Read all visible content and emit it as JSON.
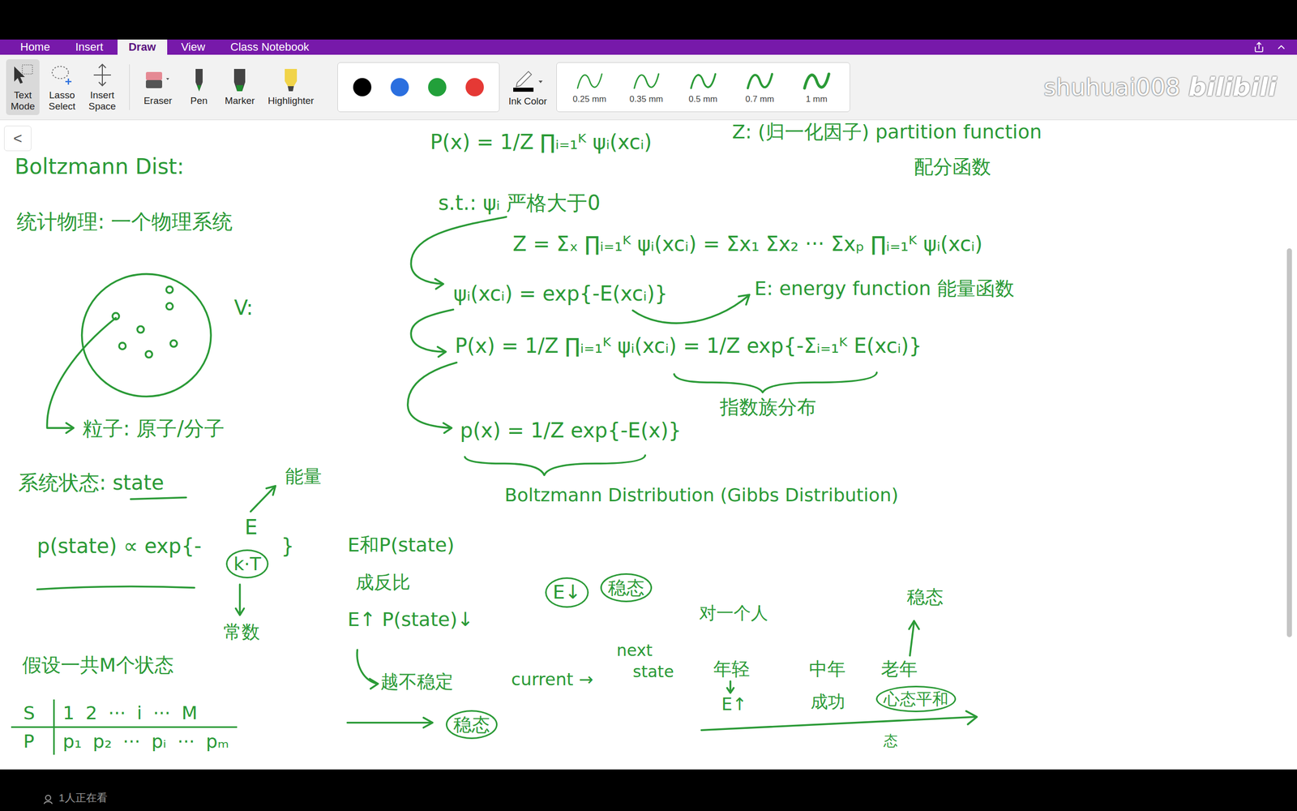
{
  "window": {
    "tabs": [
      {
        "label": "Home",
        "selected": false
      },
      {
        "label": "Insert",
        "selected": false
      },
      {
        "label": "Draw",
        "selected": true
      },
      {
        "label": "View",
        "selected": false
      },
      {
        "label": "Class Notebook",
        "selected": false
      }
    ]
  },
  "toolbar": {
    "tools": [
      {
        "label": "Text Mode",
        "selected": true
      },
      {
        "label": "Lasso Select",
        "selected": false
      },
      {
        "label": "Insert Space",
        "selected": false
      },
      {
        "label": "Eraser",
        "selected": false
      },
      {
        "label": "Pen",
        "selected": false
      },
      {
        "label": "Marker",
        "selected": false
      },
      {
        "label": "Highlighter",
        "selected": false
      }
    ],
    "colors": [
      {
        "color": "#000000"
      },
      {
        "color": "#2b6fdf"
      },
      {
        "color": "#22a03a"
      },
      {
        "color": "#e53935"
      }
    ],
    "ink_color": {
      "label": "Ink Color"
    },
    "thicknesses": [
      {
        "label": "0.25 mm"
      },
      {
        "label": "0.35 mm"
      },
      {
        "label": "0.5 mm"
      },
      {
        "label": "0.7 mm"
      },
      {
        "label": "1 mm"
      }
    ]
  },
  "watermark": {
    "user": "shuhuai008",
    "logo": "bilibili"
  },
  "canvas": {
    "back_button": "<",
    "notes": [
      {
        "text": "Boltzmann Dist:",
        "circled": false
      },
      {
        "text": "统计物理: 一个物理系统",
        "circled": false
      },
      {
        "text": "V:",
        "circled": false
      },
      {
        "text": "粒子: 原子/分子",
        "circled": false
      },
      {
        "text": "系统状态: state",
        "circled": false
      },
      {
        "text": "能量",
        "circled": false
      },
      {
        "text": "p(state) ∝ exp{-",
        "circled": false
      },
      {
        "text": "E",
        "circled": false
      },
      {
        "text": "k·T",
        "circled": true
      },
      {
        "text": "}",
        "circled": false
      },
      {
        "text": "常数",
        "circled": false
      },
      {
        "text": "假设一共M个状态",
        "circled": false
      },
      {
        "text": "P(x) = 1/Z ∏ᵢ₌₁ᴷ ψᵢ(xcᵢ)",
        "circled": false
      },
      {
        "text": "Z: (归一化因子) partition function",
        "circled": false
      },
      {
        "text": "配分函数",
        "circled": false
      },
      {
        "text": "s.t.: ψᵢ 严格大于0",
        "circled": false
      },
      {
        "text": "Z = Σₓ ∏ᵢ₌₁ᴷ ψᵢ(xcᵢ) = Σx₁ Σx₂ ··· Σxₚ ∏ᵢ₌₁ᴷ ψᵢ(xcᵢ)",
        "circled": false
      },
      {
        "text": "ψᵢ(xcᵢ) = exp{-E(xcᵢ)}",
        "circled": false
      },
      {
        "text": "E: energy function 能量函数",
        "circled": false
      },
      {
        "text": "P(x) = 1/Z ∏ᵢ₌₁ᴷ ψᵢ(xcᵢ) = 1/Z exp{-Σᵢ₌₁ᴷ E(xcᵢ)}",
        "circled": false
      },
      {
        "text": "指数族分布",
        "circled": false
      },
      {
        "text": "p(x) = 1/Z exp{-E(x)}",
        "circled": false
      },
      {
        "text": "Boltzmann Distribution (Gibbs Distribution)",
        "circled": false
      },
      {
        "text": "E和P(state)",
        "circled": false
      },
      {
        "text": "成反比",
        "circled": false
      },
      {
        "text": "E↑ P(state)↓",
        "circled": false
      },
      {
        "text": "越不稳定",
        "circled": false
      },
      {
        "text": "current →",
        "circled": false
      },
      {
        "text": "next",
        "circled": false
      },
      {
        "text": "state",
        "circled": false
      },
      {
        "text": "稳态",
        "circled": true
      },
      {
        "text": "E↓",
        "circled": true
      },
      {
        "text": "稳态",
        "circled": true
      },
      {
        "text": "对一个人",
        "circled": false
      },
      {
        "text": "年轻",
        "circled": false
      },
      {
        "text": "E↑",
        "circled": false
      },
      {
        "text": "中年",
        "circled": false
      },
      {
        "text": "成功",
        "circled": false
      },
      {
        "text": "老年",
        "circled": false
      },
      {
        "text": "心态平和",
        "circled": true
      },
      {
        "text": "稳态",
        "circled": false
      },
      {
        "text": "态",
        "circled": false
      }
    ],
    "state_table": {
      "rows": [
        {
          "head": "S",
          "cells": [
            "1",
            "2",
            "···",
            "i",
            "···",
            "M"
          ]
        },
        {
          "head": "P",
          "cells": [
            "p₁",
            "p₂",
            "···",
            "pᵢ",
            "···",
            "pₘ"
          ]
        }
      ]
    }
  },
  "status_bar": {
    "viewers": "1人正在看"
  }
}
